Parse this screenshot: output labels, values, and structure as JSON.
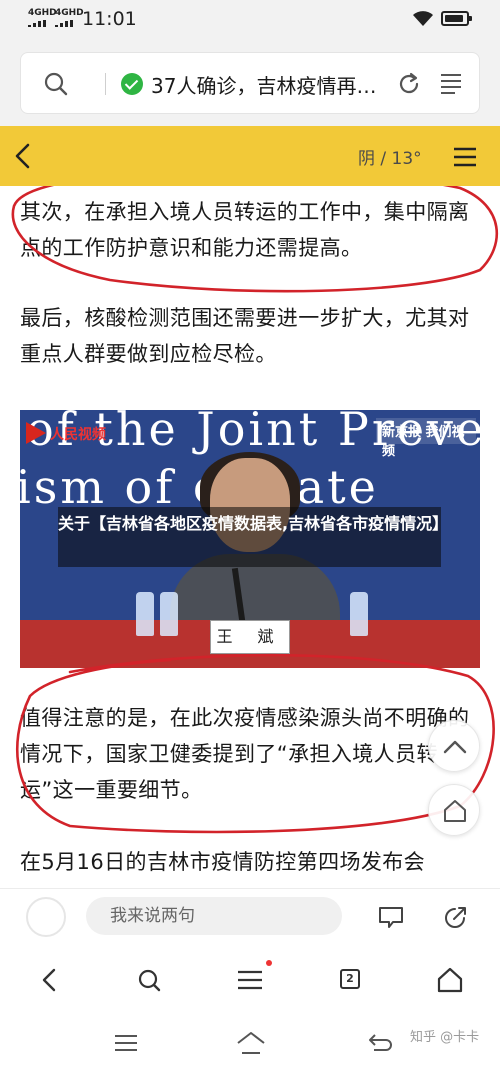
{
  "status_bar": {
    "signal_1": "4GHD",
    "signal_2": "4GHD",
    "time": "11:01"
  },
  "url_bar": {
    "title": "37人确诊，吉林疫情再…"
  },
  "article_bar": {
    "weather": "阴 / 13°"
  },
  "article": {
    "paragraphs": [
      "其次，在承担入境人员转运的工作中，集中隔离点的工作防护意识和能力还需提高。",
      "最后，核酸检测范围还需要进一步扩大，尤其对重点人群要做到应检尽检。",
      "值得注意的是，在此次疫情感染源头尚不明确的情况下，国家卫健委提到了“承担入境人员转运”这一重要细节。",
      "在5月16日的吉林市疫情防控第四场发布会"
    ],
    "photo": {
      "line_1": "of the Joint Preve",
      "line_2": "ism of  e State",
      "logo_left": "人民视频",
      "logo_right": "新京报 我们视频",
      "nameplate": "王 斌"
    },
    "caption": "关于【吉林省各地区疫情数据表,吉林省各市疫情情况】"
  },
  "comment_bar": {
    "placeholder": "我来说两句"
  },
  "toolbar": {
    "tabs_count": "2"
  },
  "watermark": "知乎 @卡卡",
  "colors": {
    "accent_yellow": "#f2c938",
    "annotation_red": "#d2232a",
    "secure_green": "#2fb543"
  }
}
